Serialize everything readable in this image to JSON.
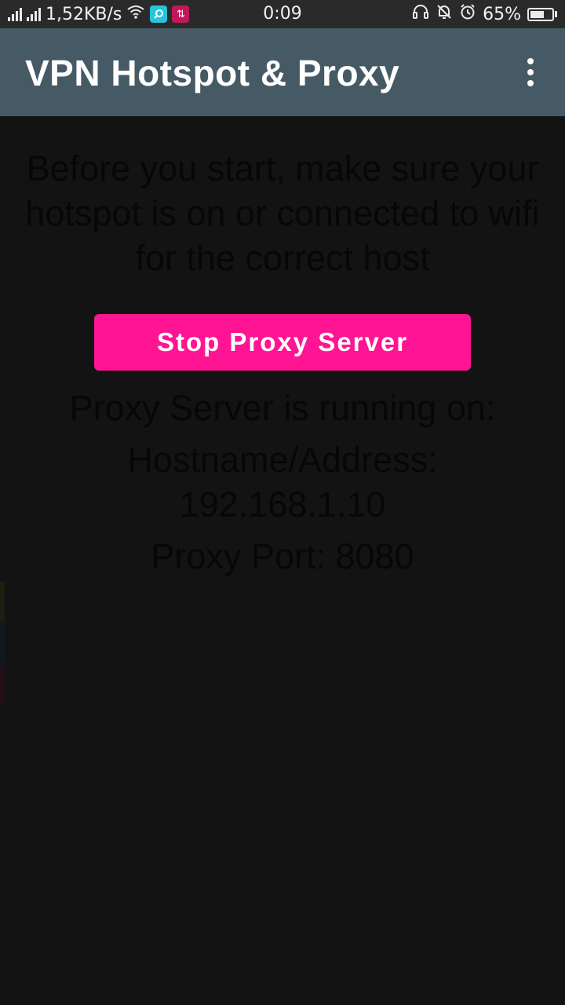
{
  "status_bar": {
    "network_speed": "1,52KB/s",
    "time": "0:09",
    "battery_percent": "65%",
    "battery_level": 0.65
  },
  "app_bar": {
    "title": "VPN Hotspot & Proxy"
  },
  "main": {
    "instructions": "Before you start, make sure your hotspot is on or connected to wifi for the correct host",
    "stop_button_label": "Stop Proxy Server",
    "running_label": "Proxy Server is running on:",
    "hostname_label": "Hostname/Address:",
    "hostname_value": "192.168.1.10",
    "port_line": "Proxy Port: 8080"
  },
  "colors": {
    "background": "#131313",
    "app_bar": "#455a64",
    "accent": "#ff1493"
  }
}
